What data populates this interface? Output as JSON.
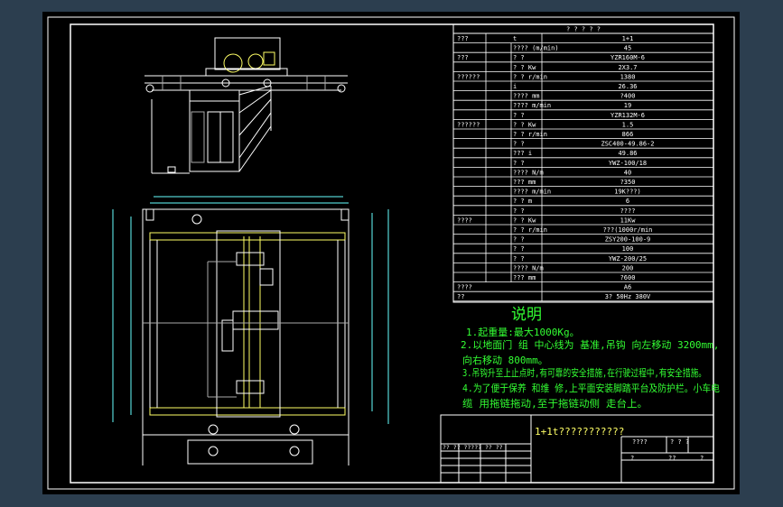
{
  "colors": {
    "outer_bg": "#2c3e4f",
    "paper": "#000000",
    "line": "#ffffff",
    "text_green": "#33ff33",
    "text_white": "#ffffff",
    "accent_yellow": "#ffff66",
    "dim_cyan": "#66ffff"
  },
  "table": {
    "header": "?    ?    ?    ?    ?",
    "rows": [
      {
        "c1": "???",
        "c2": "t",
        "c3": "1+1"
      },
      {
        "c2": "???? (m/min)",
        "c3": "45"
      },
      {
        "c1": "???",
        "c2": "? ?",
        "c3": "YZR160M-6"
      },
      {
        "c2": "? ? Kw",
        "c3": "2X3.7"
      },
      {
        "c1": "??????",
        "c2": "? ? r/min",
        "c3": "1380"
      },
      {
        "c2": "i",
        "c3": "26.36"
      },
      {
        "c2": "???? mm",
        "c3": "?400"
      },
      {
        "c2": "???? m/min",
        "c3": "19"
      },
      {
        "c2": "? ?",
        "c3": "YZR132M-6"
      },
      {
        "c1": "??????",
        "c2": "? ? Kw",
        "c3": "1.5"
      },
      {
        "c2": "? ? r/min",
        "c3": "866"
      },
      {
        "c2": "? ?",
        "c3": "ZSC400-49.86-2"
      },
      {
        "c2": "???  i",
        "c3": "49.86"
      },
      {
        "c2": "? ?",
        "c3": "YWZ-100/18"
      },
      {
        "c2": "???? N/m",
        "c3": "40"
      },
      {
        "c2": "???  mm",
        "c3": "?350"
      },
      {
        "c2": "???? m/min",
        "c3": "19K???)"
      },
      {
        "c2": "? ? m",
        "c3": "6"
      },
      {
        "c2": "? ?",
        "c3": "????"
      },
      {
        "c1": "????",
        "c2": "? ? Kw",
        "c3": "11Kw"
      },
      {
        "c2": "? ? r/min",
        "c3": "???(1000r/min"
      },
      {
        "c2": "? ?",
        "c3": "ZSY200-100-9"
      },
      {
        "c2": "? ?",
        "c3": "100"
      },
      {
        "c2": "? ?",
        "c3": "YWZ-200/25"
      },
      {
        "c2": "???? N/m",
        "c3": "200"
      },
      {
        "c2": "???  mm",
        "c3": "?600"
      },
      {
        "c1": "????",
        "c3": "A6"
      },
      {
        "c1": "??",
        "c3": "3?    50Hz     380V"
      }
    ]
  },
  "notes": {
    "heading": "说明",
    "n1": "1.起重量:最大1000Kg。",
    "n2": "2.以地面门 组 中心线为 基准,吊钩 向左移动 3200mm,",
    "n2b": "向右移动 800mm。",
    "n3": "3.吊钩升至上止点时,有可靠的安全措施,在行驶过程中,有安全措施。",
    "n4": "4.为了便于保养 和维 修,上平面安装脚踏平台及防护栏。小车电",
    "n4b": "缆 用拖链拖动,至于拖链动侧 走台上。"
  },
  "title_block": {
    "title": "1+1t???????????",
    "r1": "????",
    "r1b": "?   ?   ?",
    "r2a": "?",
    "r2b": "??",
    "r2c": "?",
    "left_hdr": "?? ?? ????? ??  ??"
  }
}
